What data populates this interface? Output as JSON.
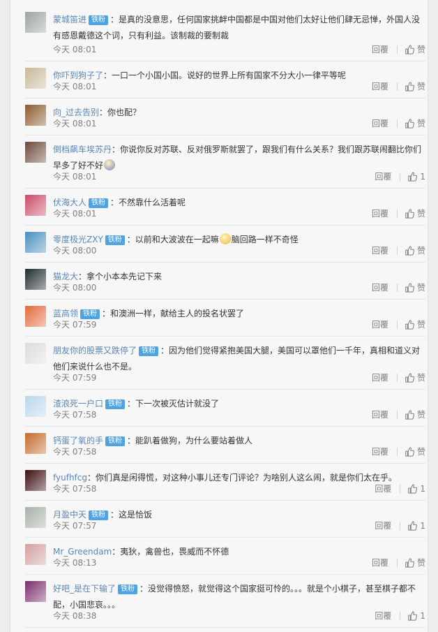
{
  "comments": [
    {
      "avatar_color": "#9aa4a0",
      "user": "蒙城笛进",
      "badge": "铁粉",
      "text": "：是真的没意思，任何国家挑衅中国都是中国对他们太好让他们肆无忌惮，外国人没有感恩戴德这个词，只有利益。该制裁的要制裁",
      "time": "今天 08:01",
      "reply": "回覆",
      "like": "赞"
    },
    {
      "avatar_color": "#c8b89a",
      "user": "你吓到狗子了",
      "badge": "",
      "text": "：一口一个小国小国。说好的世界上所有国家不分大小一律平等呢",
      "time": "今天 08:01",
      "reply": "回覆",
      "like": "赞"
    },
    {
      "avatar_color": "#8a5a2e",
      "user": "向_过去告别",
      "badge": "",
      "text": "：你也配？",
      "time": "今天 08:01",
      "reply": "回覆",
      "like": "赞"
    },
    {
      "avatar_color": "#6b4a3a",
      "user": "倒档飙车埃苏丹",
      "badge": "",
      "text": "：你说你反对苏联、反对俄罗斯就罢了，跟我们有什么关系？我们跟苏联闹翻比你们早多了好不好",
      "emoji": "#7a7fc8",
      "time": "今天 08:01",
      "reply": "回覆",
      "like": "1"
    },
    {
      "avatar_color": "#c94c6a",
      "user": "伏海大人",
      "badge": "铁粉",
      "text": "：不然靠什么活着呢",
      "time": "今天 08:01",
      "reply": "回覆",
      "like": "赞"
    },
    {
      "avatar_color": "#4a8fc0",
      "user": "零度极光ZXY",
      "badge": "铁粉",
      "text": "：以前和大波波在一起嘛",
      "emoji": "#f2b43c",
      "text2": "脑回路一样不奇怪",
      "time": "今天 08:00",
      "reply": "回覆",
      "like": "赞"
    },
    {
      "avatar_color": "#1f2a2e",
      "user": "猫龙大",
      "badge": "",
      "text": "：拿个小本本先记下来",
      "time": "今天 08:00",
      "reply": "回覆",
      "like": "赞"
    },
    {
      "avatar_color": "#e26a3c",
      "user": "蓝高领",
      "badge": "铁粉",
      "text": "：和澳洲一样，献给主人的投名状罢了",
      "time": "今天 07:59",
      "reply": "回覆",
      "like": "赞"
    },
    {
      "avatar_color": "#dcdcdc",
      "user": "朋友你的股票又跌停了",
      "badge": "铁粉",
      "text": "：因为他们觉得紧抱美国大腿，美国可以罩他们一千年，真相和道义对他们来说什么也不是。",
      "time": "今天 07:59",
      "reply": "回覆",
      "like": "赞"
    },
    {
      "avatar_color": "#b9d7ea",
      "user": "渣浪死一户口",
      "badge": "铁粉",
      "text": "：下一次被灭估计就没了",
      "time": "今天 07:58",
      "reply": "回覆",
      "like": "赞"
    },
    {
      "avatar_color": "#c46a2a",
      "user": "钙蛋了氧的手",
      "badge": "铁粉",
      "text": "：能趴着做狗，为什么要站着做人",
      "time": "今天 07:58",
      "reply": "回覆",
      "like": "赞"
    },
    {
      "avatar_color": "#3a0c10",
      "user": "fyufhfcg",
      "badge": "",
      "text": "：你们真是闲得慌，对这种小事儿还专门评论？为啥别人这么闹，就是你们太在乎。",
      "time": "今天 07:58",
      "reply": "回覆",
      "like": "1"
    },
    {
      "avatar_color": "#a8b0a8",
      "user": "月盈中天",
      "badge": "铁粉",
      "text": "：这是恰饭",
      "time": "今天 07:57",
      "reply": "回覆",
      "like": "1"
    },
    {
      "avatar_color": "#d4a0a0",
      "user": "Mr_Greendam",
      "badge": "",
      "text": "：夷狄，禽兽也，畏威而不怀德",
      "time": "今天 08:13",
      "reply": "回覆",
      "like": "赞"
    },
    {
      "avatar_color": "#7a2c6a",
      "user": "好吧_是在下输了",
      "badge": "铁粉",
      "text": "：没觉得愤怒，就觉得这个国家挺可怜的。。。就是个小棋子，甚至棋子都不配，小国悲哀。。。",
      "time": "今天 08:38",
      "reply": "回覆",
      "like": "1"
    }
  ]
}
